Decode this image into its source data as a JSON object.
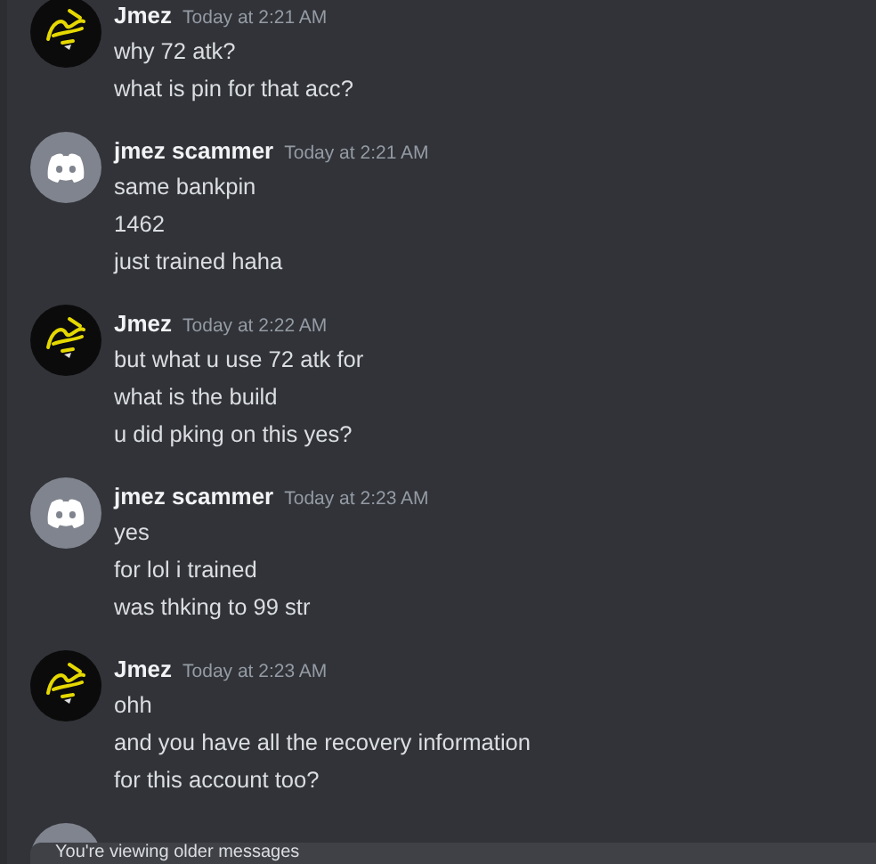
{
  "messages": [
    {
      "author": "Jmez",
      "kind": "logo",
      "timestamp": "Today at 2:21 AM",
      "lines": [
        "why 72 atk?",
        "what is pin for that acc?"
      ]
    },
    {
      "author": "jmez scammer",
      "kind": "default",
      "timestamp": "Today at 2:21 AM",
      "lines": [
        "same bankpin",
        "1462",
        "just trained haha"
      ]
    },
    {
      "author": "Jmez",
      "kind": "logo",
      "timestamp": "Today at 2:22 AM",
      "lines": [
        "but what u use 72 atk for",
        "what is the build",
        "u did pking on this yes?"
      ]
    },
    {
      "author": "jmez scammer",
      "kind": "default",
      "timestamp": "Today at 2:23 AM",
      "lines": [
        "yes",
        "for lol i trained",
        "was thking to 99 str"
      ]
    },
    {
      "author": "Jmez",
      "kind": "logo",
      "timestamp": "Today at 2:23 AM",
      "lines": [
        "ohh",
        "and you have all the recovery information",
        "for this account too?"
      ]
    },
    {
      "kind": "default"
    }
  ],
  "older_messages_bar": {
    "text": "You're viewing older messages"
  }
}
